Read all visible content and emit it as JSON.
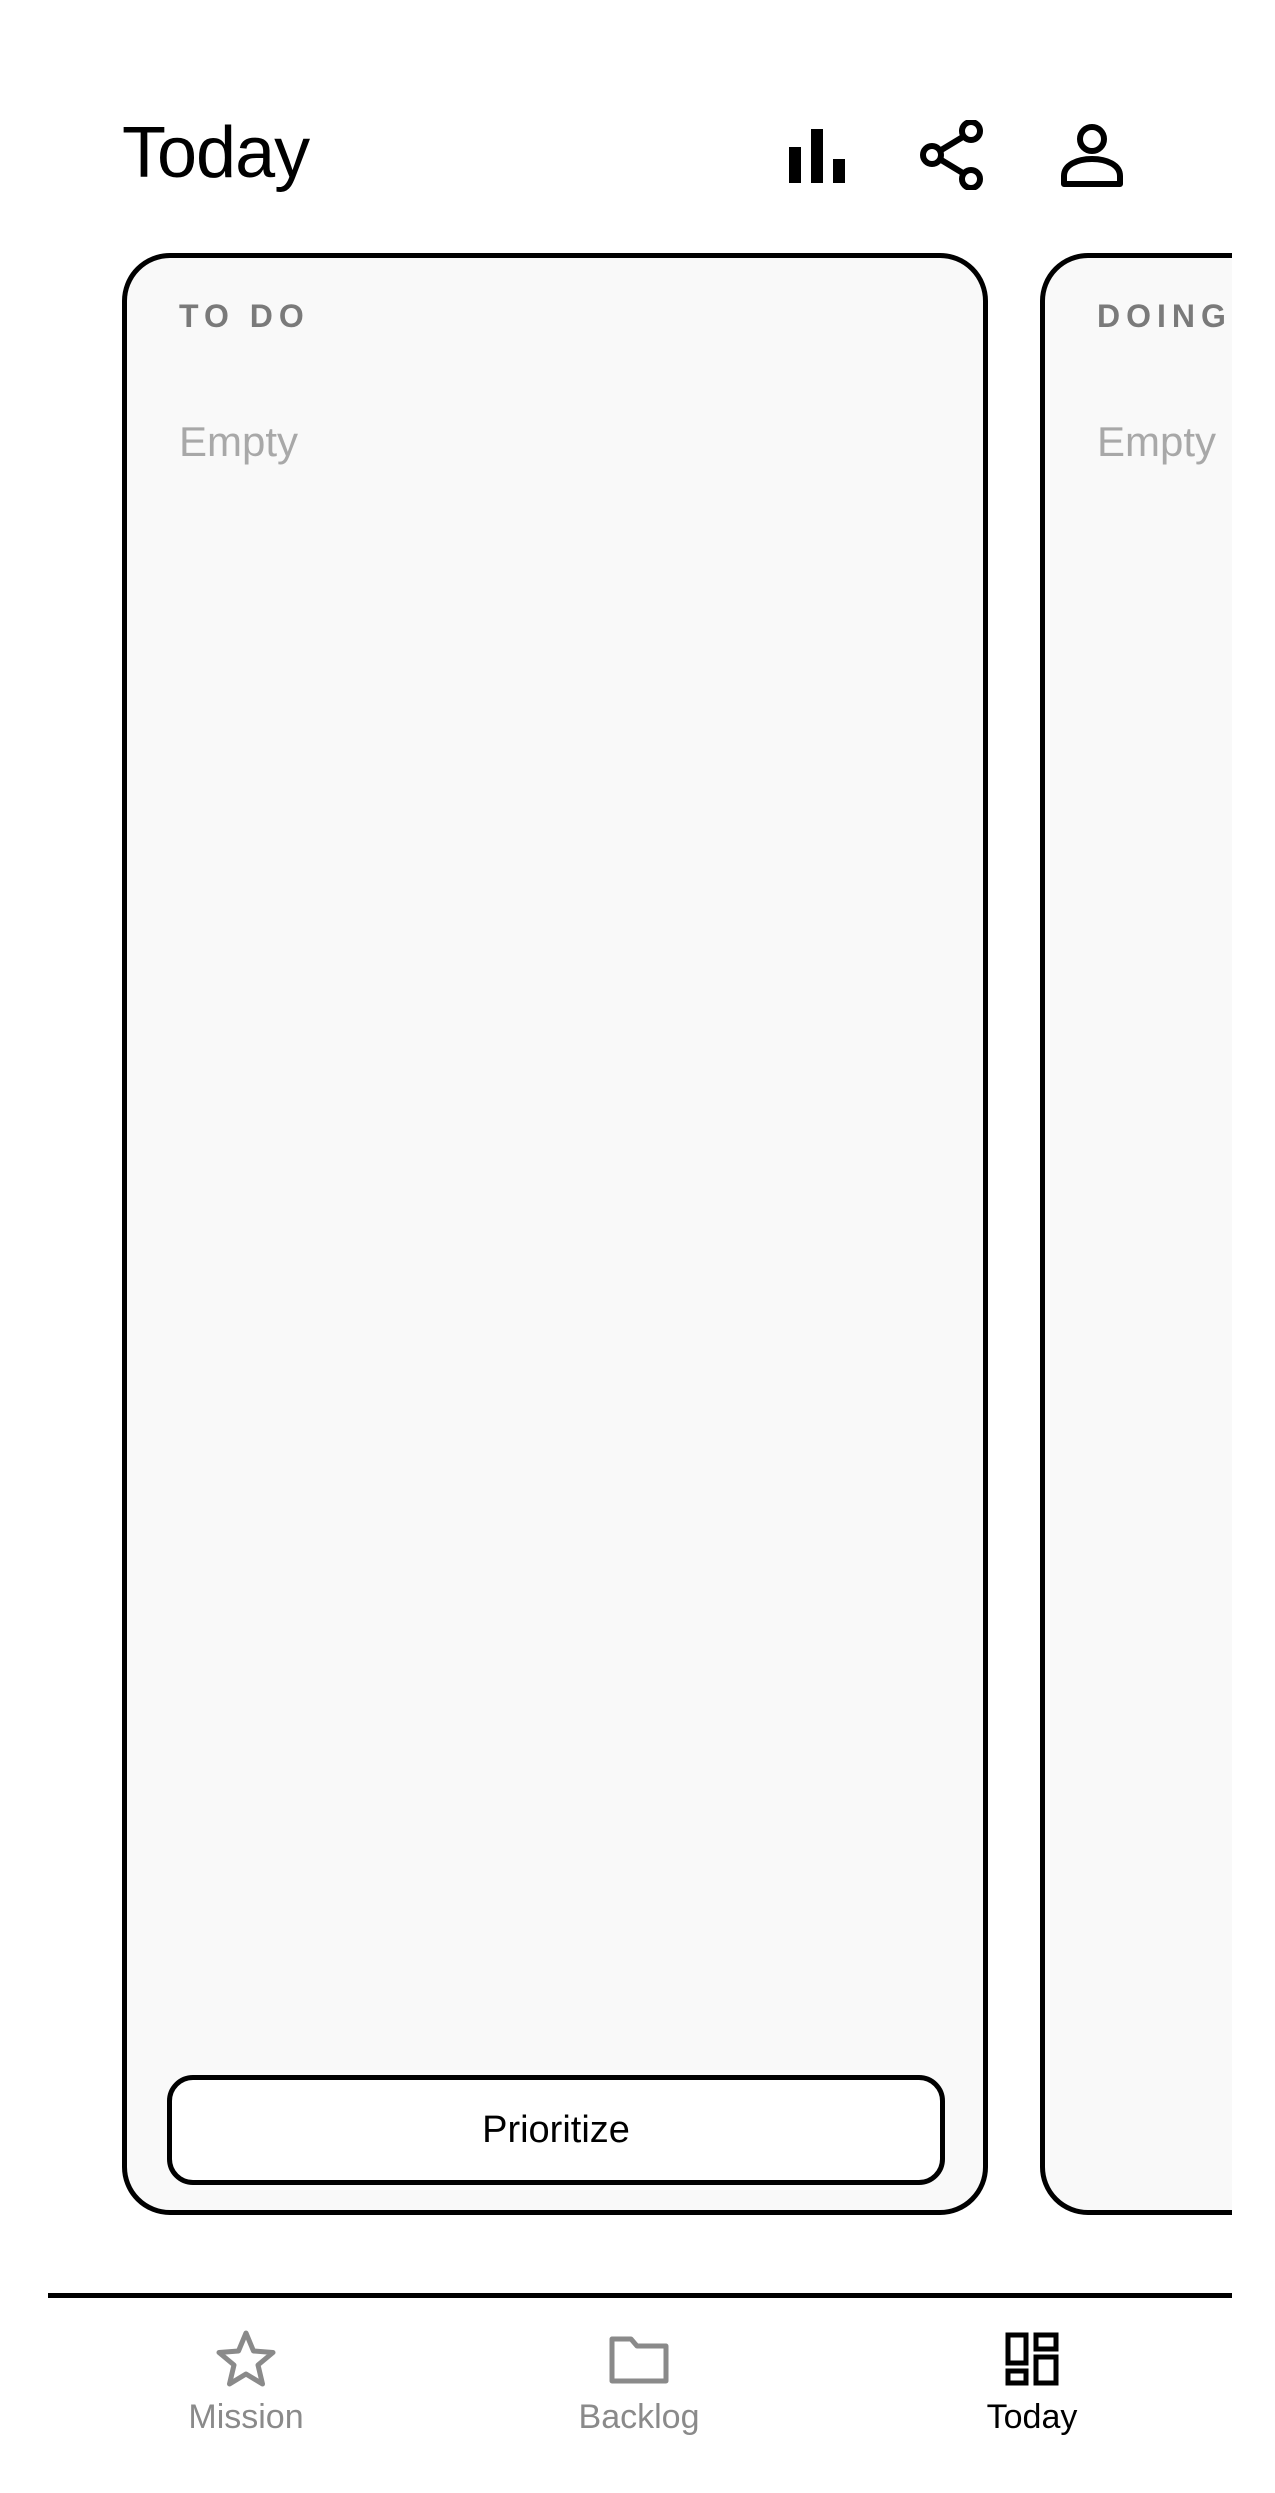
{
  "header": {
    "title": "Today",
    "icons": [
      "bar-chart-icon",
      "share-icon",
      "profile-icon"
    ]
  },
  "columns": [
    {
      "title": "TO DO",
      "empty_text": "Empty",
      "action_label": "Prioritize"
    },
    {
      "title": "DOING",
      "empty_text": "Empty"
    }
  ],
  "bottom_nav": {
    "items": [
      {
        "label": "Mission",
        "icon": "star-icon",
        "active": false
      },
      {
        "label": "Backlog",
        "icon": "folder-icon",
        "active": false
      },
      {
        "label": "Today",
        "icon": "dashboard-icon",
        "active": true
      }
    ]
  },
  "colors": {
    "column_bg": "#f9f9f9",
    "border": "#000000",
    "muted_text": "#7a7a7a",
    "placeholder_text": "#a8a8a8",
    "nav_inactive": "#8a8a8a",
    "nav_active": "#000000"
  }
}
